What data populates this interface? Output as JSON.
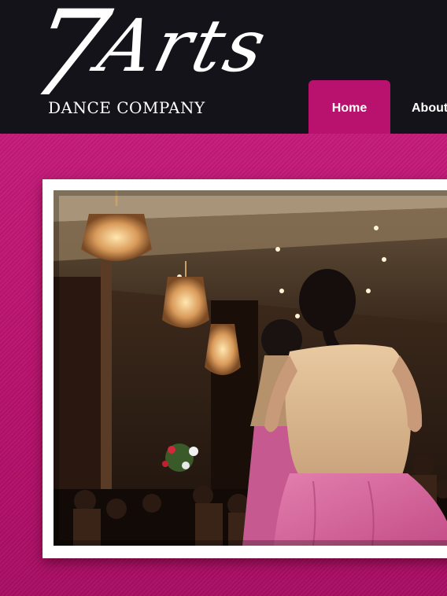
{
  "logo": {
    "numeral": "7",
    "word": "Arts",
    "subtitle": "DANCE COMPANY"
  },
  "nav": {
    "items": [
      {
        "label": "Home",
        "active": true
      },
      {
        "label": "About",
        "active": false
      }
    ]
  },
  "colors": {
    "header_bg": "#141319",
    "accent": "#b8126e",
    "frame": "#ffffff"
  },
  "hero": {
    "image": "dance-performance-photo"
  }
}
